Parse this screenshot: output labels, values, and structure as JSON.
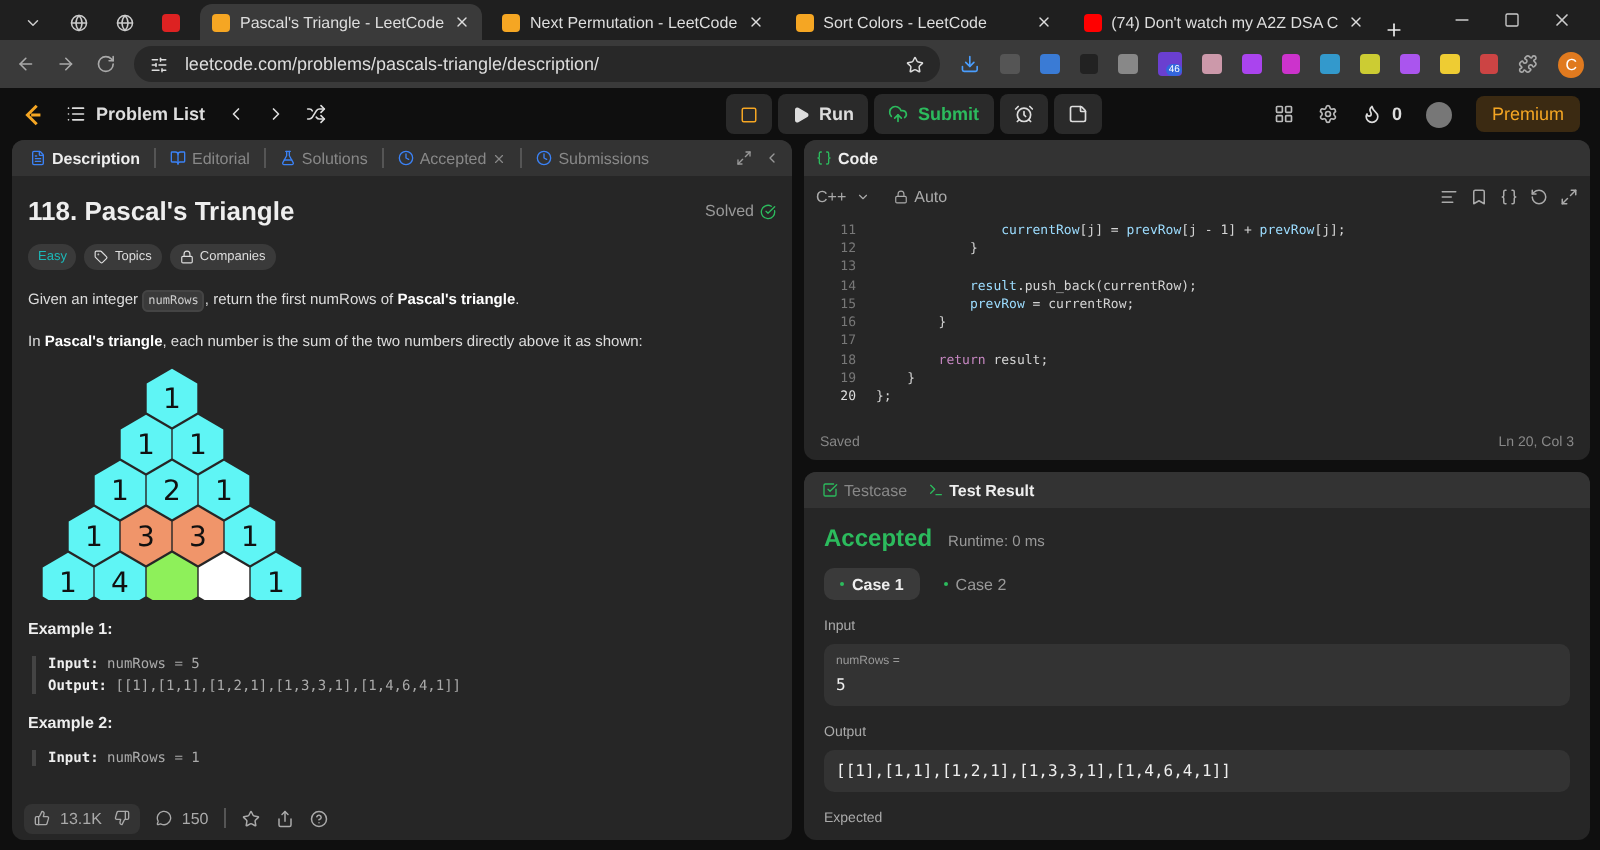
{
  "browser": {
    "tabs": [
      {
        "title": "Pascal's Triangle - LeetCode",
        "selected": true
      },
      {
        "title": "Next Permutation - LeetCode",
        "selected": false
      },
      {
        "title": "Sort Colors - LeetCode",
        "selected": false
      },
      {
        "title": "(74) Don't watch my A2Z DSA C",
        "selected": false
      }
    ],
    "url": "leetcode.com/problems/pascals-triangle/description/",
    "extension_badge": "46",
    "profile_initial": "C"
  },
  "header": {
    "problem_list": "Problem List",
    "run": "Run",
    "submit": "Submit",
    "streak": "0",
    "premium": "Premium"
  },
  "description_panel": {
    "tabs": [
      {
        "label": "Description",
        "selected": true
      },
      {
        "label": "Editorial",
        "selected": false
      },
      {
        "label": "Solutions",
        "selected": false
      },
      {
        "label": "Accepted",
        "selected": false,
        "closable": true
      },
      {
        "label": "Submissions",
        "selected": false
      }
    ],
    "title": "118. Pascal's Triangle",
    "status": "Solved",
    "difficulty": "Easy",
    "chips": [
      "Topics",
      "Companies"
    ],
    "paragraphs": [
      [
        {
          "kind": "text",
          "text": "Given an integer "
        },
        {
          "kind": "code",
          "text": "numRows"
        },
        {
          "kind": "text",
          "text": ", return the first numRows of **Pascal's triangle**."
        }
      ],
      [
        {
          "kind": "text",
          "text": "In **Pascal's triangle**, each number is the sum of the two numbers directly above it as shown:"
        }
      ]
    ],
    "triangle": [
      [
        {
          "value": "1",
          "color": "#5ff5f5"
        }
      ],
      [
        {
          "value": "1",
          "color": "#5ff5f5"
        },
        {
          "value": "1",
          "color": "#5ff5f5"
        }
      ],
      [
        {
          "value": "1",
          "color": "#5ff5f5"
        },
        {
          "value": "2",
          "color": "#5ff5f5"
        },
        {
          "value": "1",
          "color": "#5ff5f5"
        }
      ],
      [
        {
          "value": "1",
          "color": "#5ff5f5"
        },
        {
          "value": "3",
          "color": "#f0956a"
        },
        {
          "value": "3",
          "color": "#f0956a"
        },
        {
          "value": "1",
          "color": "#5ff5f5"
        }
      ],
      [
        {
          "value": "1",
          "color": "#5ff5f5"
        },
        {
          "value": "4",
          "color": "#5ff5f5"
        },
        {
          "color": "#8ef05a"
        },
        {
          "color": "#ffffff"
        },
        {
          "value": "1",
          "color": "#5ff5f5"
        }
      ]
    ],
    "examples": [
      {
        "title": "Example 1:",
        "lines": [
          {
            "label": "Input:",
            "value": "numRows = 5"
          },
          {
            "label": "Output:",
            "value": "[[1],[1,1],[1,2,1],[1,3,3,1],[1,4,6,4,1]]"
          }
        ]
      },
      {
        "title": "Example 2:",
        "lines": [
          {
            "label": "Input:",
            "value": "numRows = 1"
          }
        ]
      }
    ],
    "footer": {
      "likes": "13.1K",
      "comments": "150"
    }
  },
  "code_panel": {
    "title": "Code",
    "language": "C++",
    "mode": "Auto",
    "lines": [
      {
        "number": "11",
        "tokens": [
          {
            "kind": "var",
            "text": "                currentRow"
          },
          {
            "kind": "plain",
            "text": "[j] = "
          },
          {
            "kind": "var",
            "text": "prevRow"
          },
          {
            "kind": "plain",
            "text": "[j - 1] + "
          },
          {
            "kind": "var",
            "text": "prevRow"
          },
          {
            "kind": "plain",
            "text": "[j];"
          }
        ]
      },
      {
        "number": "12",
        "tokens": [
          {
            "kind": "plain",
            "text": "            }"
          }
        ]
      },
      {
        "number": "13"
      },
      {
        "number": "14",
        "tokens": [
          {
            "kind": "var",
            "text": "            result"
          },
          {
            "kind": "plain",
            "text": ".push_back(currentRow);"
          }
        ]
      },
      {
        "number": "15",
        "tokens": [
          {
            "kind": "var",
            "text": "            prevRow"
          },
          {
            "kind": "plain",
            "text": " = currentRow;"
          }
        ]
      },
      {
        "number": "16",
        "tokens": [
          {
            "kind": "plain",
            "text": "        }"
          }
        ]
      },
      {
        "number": "17"
      },
      {
        "number": "18",
        "tokens": [
          {
            "kind": "keyword",
            "text": "        return"
          },
          {
            "kind": "plain",
            "text": " result;"
          }
        ]
      },
      {
        "number": "19",
        "tokens": [
          {
            "kind": "plain",
            "text": "    }"
          }
        ]
      },
      {
        "number": "20",
        "current": true,
        "tokens": [
          {
            "kind": "plain",
            "text": "};"
          }
        ]
      }
    ],
    "saved": "Saved",
    "cursor": "Ln 20, Col 3"
  },
  "result_panel": {
    "tabs": [
      {
        "label": "Testcase",
        "selected": false
      },
      {
        "label": "Test Result",
        "selected": true
      }
    ],
    "verdict": "Accepted",
    "runtime": "Runtime: 0 ms",
    "cases": [
      {
        "label": "Case 1",
        "selected": true
      },
      {
        "label": "Case 2",
        "selected": false
      }
    ],
    "input_label": "Input",
    "input_name": "numRows =",
    "input_value": "5",
    "output_label": "Output",
    "output_value": "[[1],[1,1],[1,2,1],[1,3,3,1],[1,4,6,4,1]]",
    "expected_label": "Expected"
  }
}
